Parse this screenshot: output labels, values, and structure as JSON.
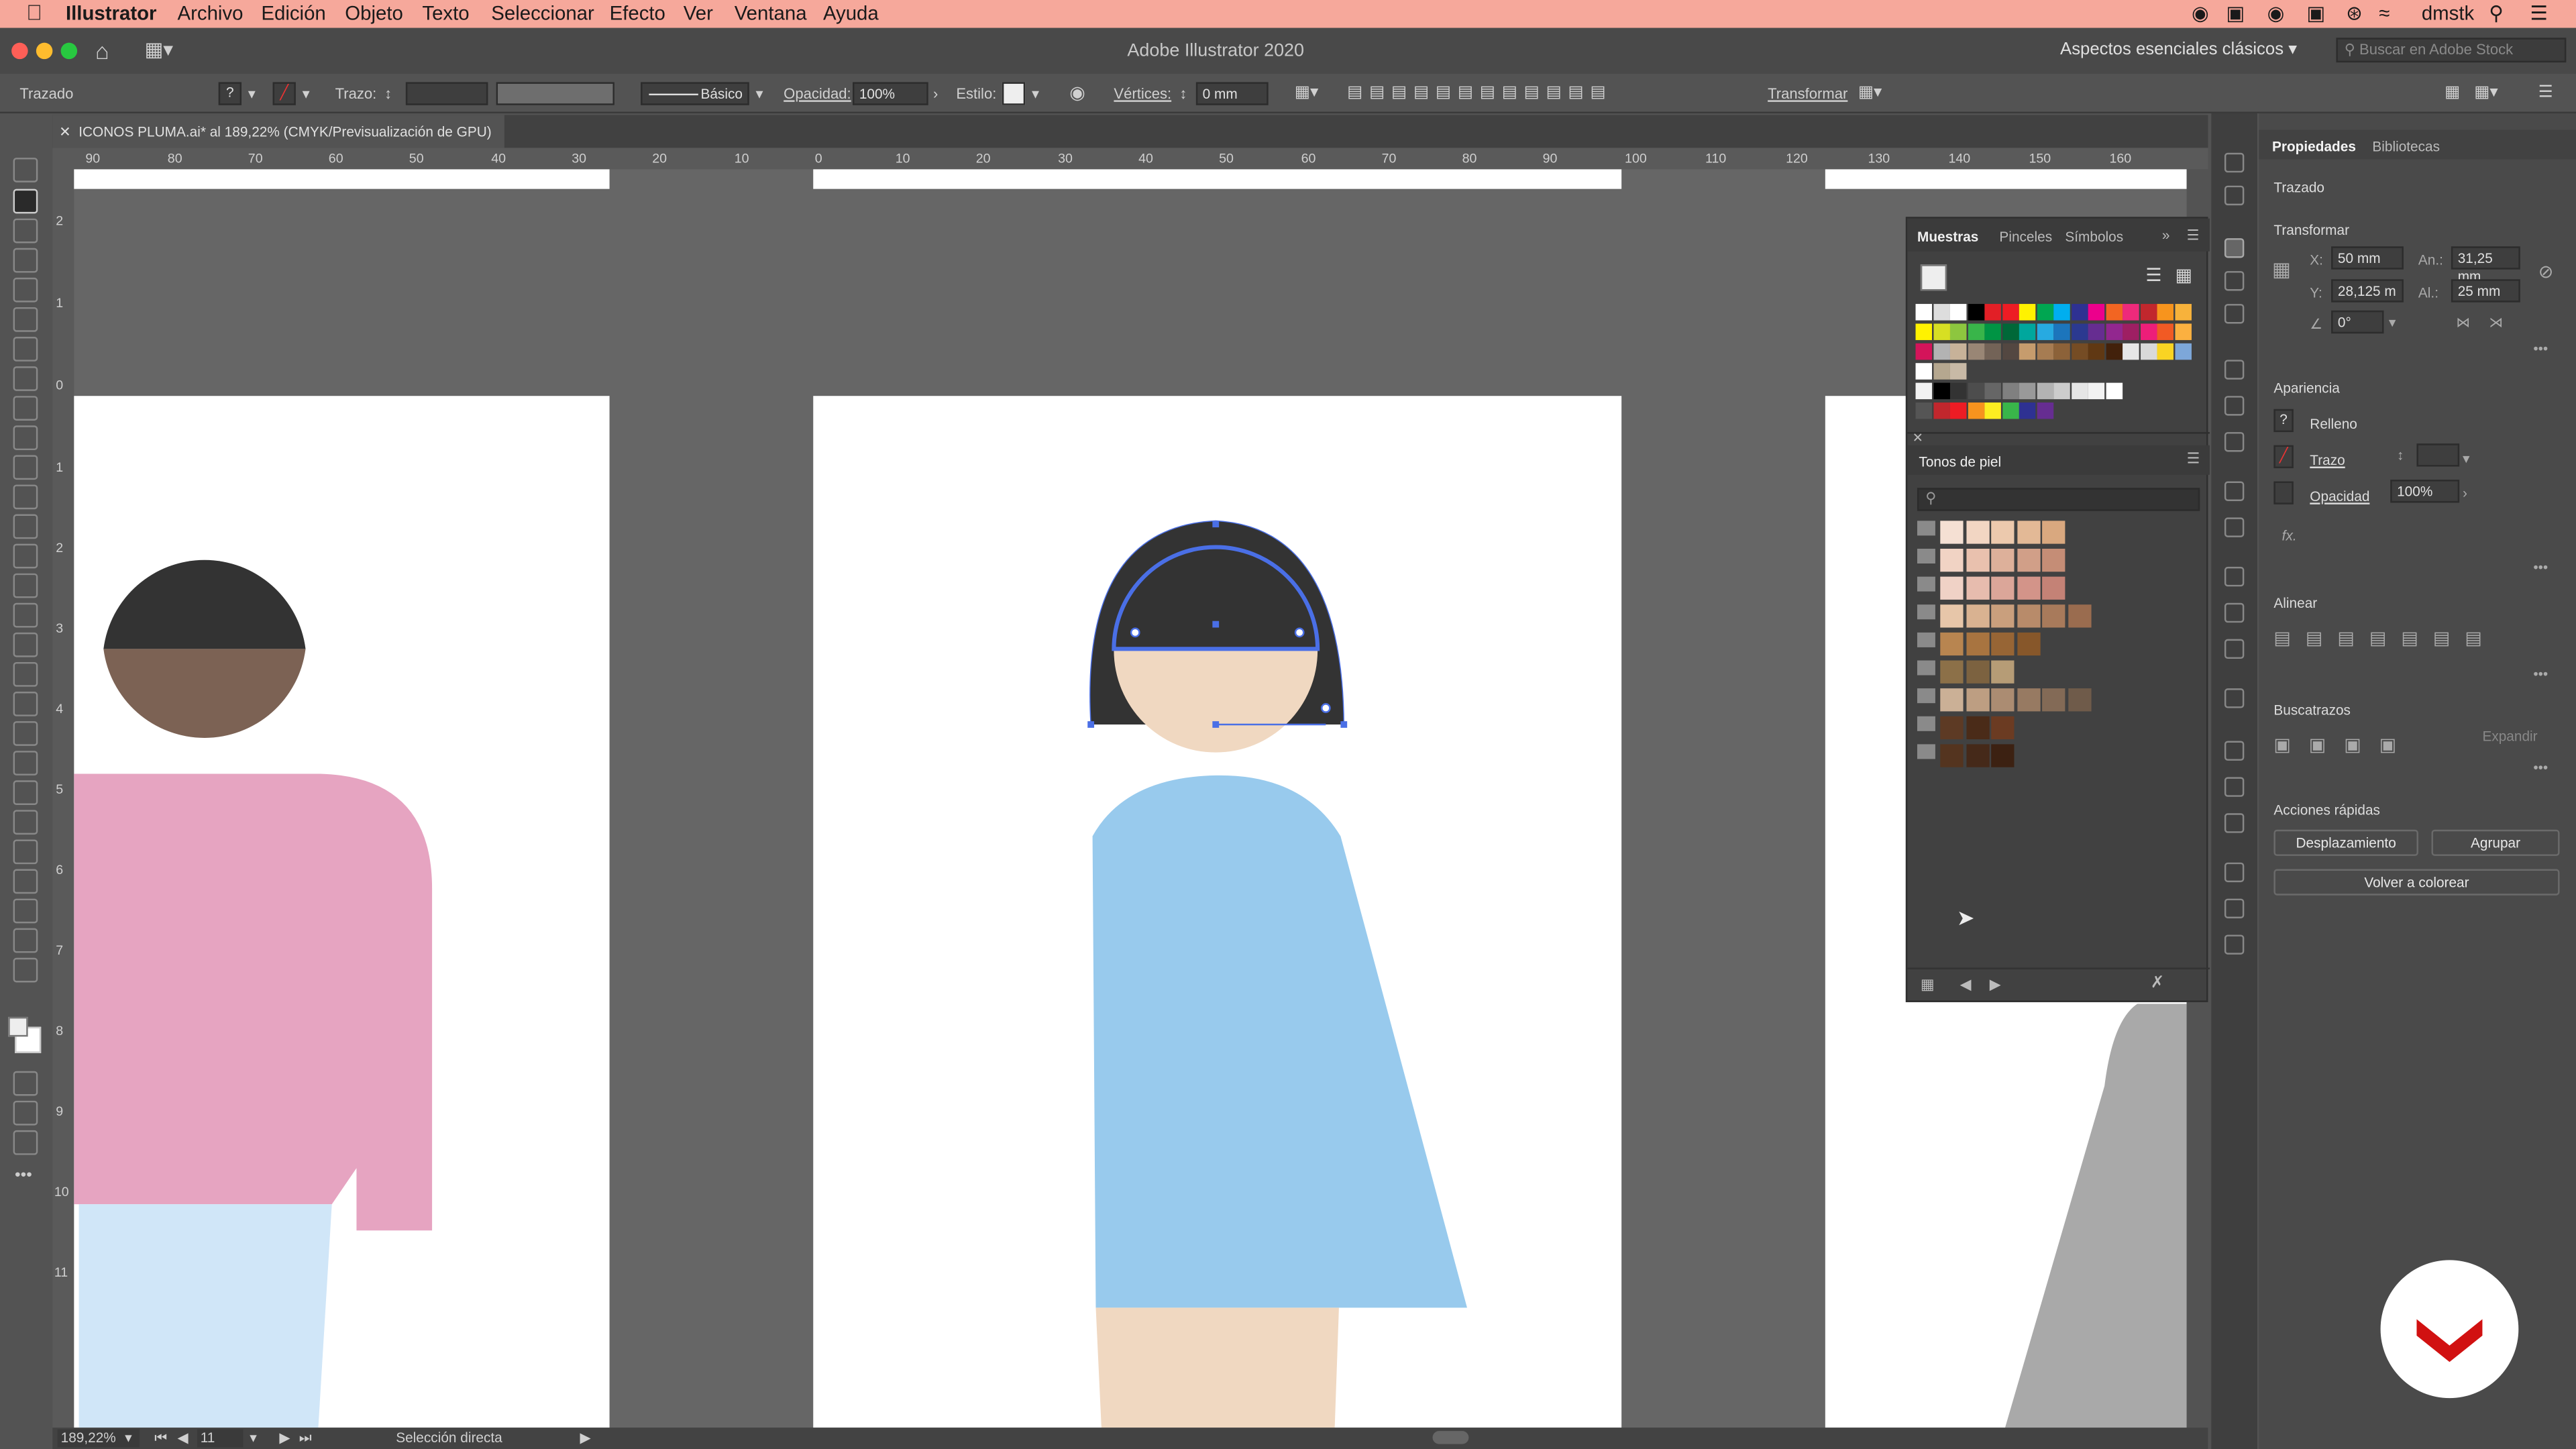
{
  "menubar": {
    "app_name": "Illustrator",
    "items": [
      "Archivo",
      "Edición",
      "Objeto",
      "Texto",
      "Seleccionar",
      "Efecto",
      "Ver",
      "Ventana",
      "Ayuda"
    ],
    "user": "dmstk"
  },
  "titlebar": {
    "title": "Adobe Illustrator 2020",
    "workspace": "Aspectos esenciales clásicos",
    "search_placeholder": "Buscar en Adobe Stock"
  },
  "control": {
    "object_type": "Trazado",
    "stroke_label": "Trazo:",
    "brush_name": "Básico",
    "opacity_label": "Opacidad:",
    "opacity_value": "100%",
    "style_label": "Estilo:",
    "vertices_label": "Vértices:",
    "vertices_value": "0 mm",
    "transform_label": "Transformar"
  },
  "document": {
    "tab_title": "ICONOS PLUMA.ai* al 189,22% (CMYK/Previsualización de GPU)"
  },
  "ruler": {
    "ticks": [
      "90",
      "80",
      "70",
      "60",
      "50",
      "40",
      "30",
      "20",
      "10",
      "0",
      "10",
      "20",
      "30",
      "40",
      "50",
      "60",
      "70",
      "80",
      "90",
      "100",
      "110",
      "120",
      "130",
      "140",
      "150",
      "160"
    ],
    "v_ticks": [
      "2",
      "1",
      "0",
      "1",
      "2",
      "3",
      "4",
      "5",
      "6",
      "7",
      "8",
      "9",
      "10",
      "11"
    ]
  },
  "status": {
    "zoom": "189,22%",
    "artboard": "11",
    "tool": "Selección directa"
  },
  "swatches_panel": {
    "tabs": [
      "Muestras",
      "Pinceles",
      "Símbolos"
    ],
    "library_title": "Tonos de piel",
    "search_placeholder": ""
  },
  "properties": {
    "tabs": [
      "Propiedades",
      "Bibliotecas"
    ],
    "object": "Trazado",
    "transform_title": "Transformar",
    "x_label": "X:",
    "x_value": "50 mm",
    "y_label": "Y:",
    "y_value": "28,125 m",
    "w_label": "An.:",
    "w_value": "31,25 mm",
    "h_label": "Al.:",
    "h_value": "25 mm",
    "angle_value": "0°",
    "appearance_title": "Apariencia",
    "fill_label": "Relleno",
    "stroke_label": "Trazo",
    "opacity_label": "Opacidad",
    "opacity_value": "100%",
    "fx_label": "fx.",
    "align_title": "Alinear",
    "pathfinder_title": "Buscatrazos",
    "expand_label": "Expandir",
    "quick_actions_title": "Acciones rápidas",
    "offset_button": "Desplazamiento",
    "group_button": "Agrupar",
    "recolor_button": "Volver a colorear"
  },
  "colors": {
    "menubar_bg": "#f6a89b",
    "hair": "#333333",
    "skin_light": "#f0d8c1",
    "skin_dark": "#7c6254",
    "shirt_pink": "#e6a4c1",
    "dress_blue": "#98caed",
    "pants_light": "#d0e6f8",
    "selection_blue": "#4a6fe6",
    "logo_red": "#d11111"
  }
}
